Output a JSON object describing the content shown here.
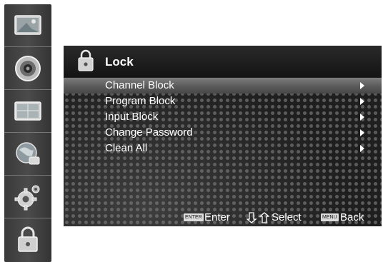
{
  "sidebar": {
    "items": [
      {
        "icon": "picture-icon"
      },
      {
        "icon": "sound-icon"
      },
      {
        "icon": "channel-icon"
      },
      {
        "icon": "network-icon"
      },
      {
        "icon": "settings-icon"
      },
      {
        "icon": "lock-icon"
      }
    ]
  },
  "panel": {
    "title": "Lock",
    "menu": [
      {
        "label": "Channel Block",
        "selected": true
      },
      {
        "label": "Program Block",
        "selected": false
      },
      {
        "label": "Input Block",
        "selected": false
      },
      {
        "label": "Change Password",
        "selected": false
      },
      {
        "label": "Clean All",
        "selected": false
      }
    ]
  },
  "footer": {
    "enter_key": "ENTER",
    "enter_label": "Enter",
    "select_label": "Select",
    "menu_key": "MENU",
    "back_label": "Back"
  }
}
